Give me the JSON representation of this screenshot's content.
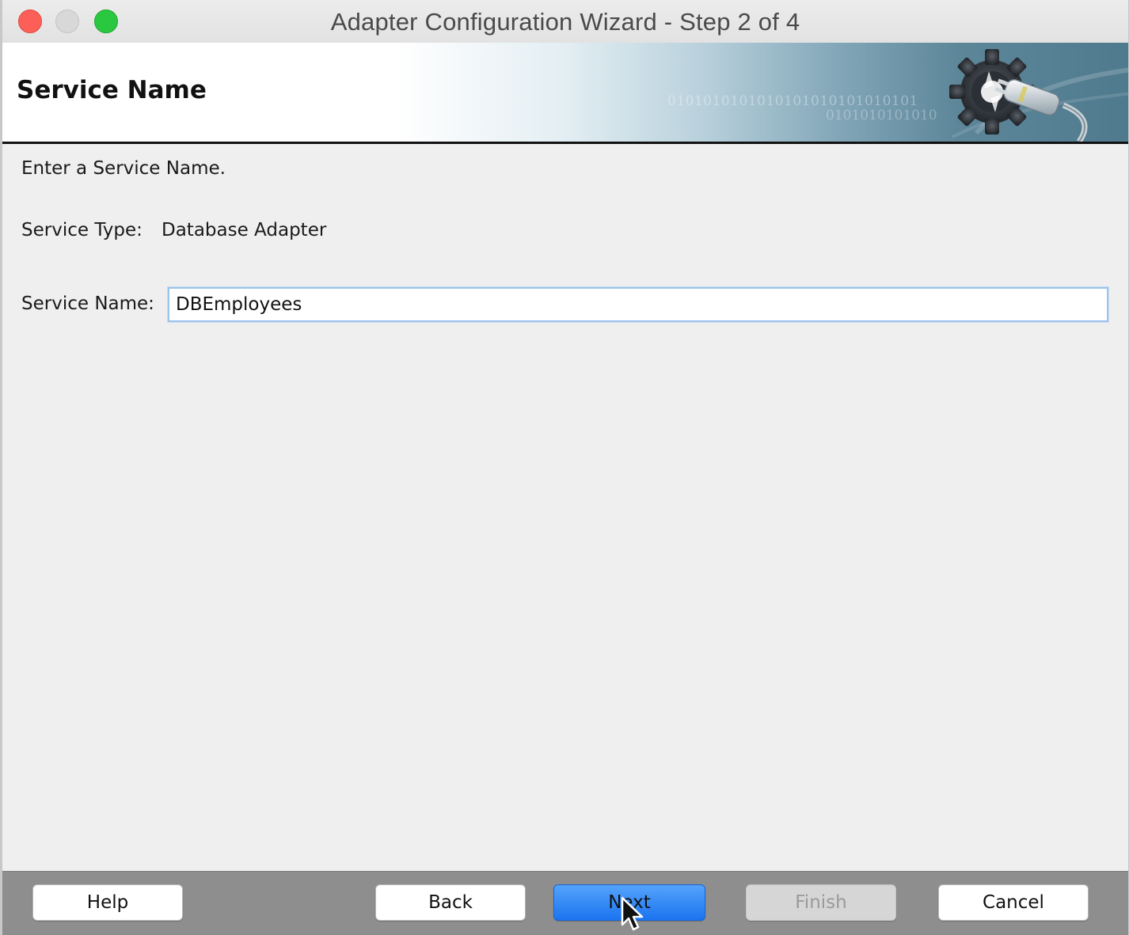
{
  "window": {
    "title": "Adapter Configuration Wizard - Step 2 of 4"
  },
  "header": {
    "title": "Service Name",
    "decoration_text_1": "0101010101010101010101010101",
    "decoration_text_2": "0101010101010"
  },
  "main": {
    "instruction": "Enter a Service Name.",
    "service_type_label": "Service Type:",
    "service_type_value": "Database Adapter",
    "service_name_label": "Service Name:",
    "service_name_value": "DBEmployees"
  },
  "footer": {
    "help_label": "Help",
    "back_label": "Back",
    "next_label": "Next",
    "finish_label": "Finish",
    "cancel_label": "Cancel"
  },
  "colors": {
    "primary_button": "#2a80f5",
    "disabled_button": "#d6d6d6",
    "footer_bg": "#8e8e8e",
    "close_light": "#fc5f57",
    "maximize_light": "#2ac840"
  },
  "icons": {
    "banner": "gear-plug-icon",
    "cursor": "mouse-pointer-icon"
  }
}
